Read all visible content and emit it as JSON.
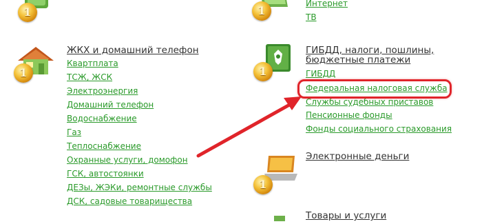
{
  "categories": {
    "internet_tv": {
      "links": [
        "Интернет",
        "ТВ"
      ]
    },
    "housing": {
      "title": "ЖКХ и домашний телефон",
      "links": [
        "Квартплата",
        "ТСЖ, ЖСК",
        "Электроэнергия",
        "Домашний телефон",
        "Водоснабжение",
        "Газ",
        "Теплоснабжение",
        "Охранные услуги, домофон",
        "ГСК, автостоянки",
        "ДЕЗы, ЖЭКи, ремонтные службы",
        "ДСК, садовые товарищества"
      ]
    },
    "gibdd": {
      "title_line1": "ГИБДД, налоги, пошлины,",
      "title_line2": "бюджетные платежи",
      "links": [
        "ГИБДД",
        "Федеральная налоговая служба",
        "Службы судебных приставов",
        "Пенсионные фонды",
        "Фонды социального страхования"
      ]
    },
    "emoney": {
      "title": "Электронные деньги"
    },
    "goods": {
      "title": "Товары и услуги"
    }
  },
  "coin_symbol": "1",
  "colors": {
    "link": "#2a9a2a",
    "title": "#333333",
    "highlight": "#e0242a",
    "arrow": "#e0242a"
  },
  "highlighted_link": "Федеральная налоговая служба",
  "icons": [
    "globe-icon",
    "house-icon",
    "emblem-icon",
    "laptop-icon",
    "box-icon",
    "coin-icon"
  ]
}
